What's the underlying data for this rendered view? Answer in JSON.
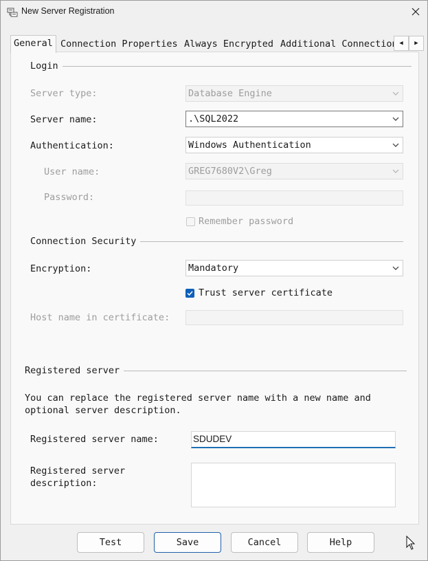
{
  "window": {
    "title": "New Server Registration"
  },
  "tabs": [
    {
      "label": "General",
      "active": true
    },
    {
      "label": "Connection Properties"
    },
    {
      "label": "Always Encrypted"
    },
    {
      "label": "Additional Connection"
    }
  ],
  "login": {
    "section_title": "Login",
    "server_type_label": "Server type:",
    "server_type_value": "Database Engine",
    "server_name_label": "Server name:",
    "server_name_value": ".\\SQL2022",
    "authentication_label": "Authentication:",
    "authentication_value": "Windows Authentication",
    "user_name_label": "User name:",
    "user_name_value": "GREG7680V2\\Greg",
    "password_label": "Password:",
    "remember_password_label": "Remember password"
  },
  "connection_security": {
    "section_title": "Connection Security",
    "encryption_label": "Encryption:",
    "encryption_value": "Mandatory",
    "trust_cert_label": "Trust server certificate",
    "trust_cert_checked": true,
    "host_name_label": "Host name in certificate:"
  },
  "registered_server": {
    "section_title": "Registered server",
    "description_line1": "You can replace the registered server name with a new name and",
    "description_line2": "optional server description.",
    "name_label": "Registered server name:",
    "name_value": "SDUDEV",
    "desc_label_line1": "Registered server",
    "desc_label_line2": "description:",
    "desc_value": ""
  },
  "buttons": {
    "test": "Test",
    "save": "Save",
    "cancel": "Cancel",
    "help": "Help"
  },
  "colors": {
    "accent": "#0f5fb8",
    "focus_underline": "#1f6fb5",
    "disabled_text": "#9d9d9d"
  }
}
